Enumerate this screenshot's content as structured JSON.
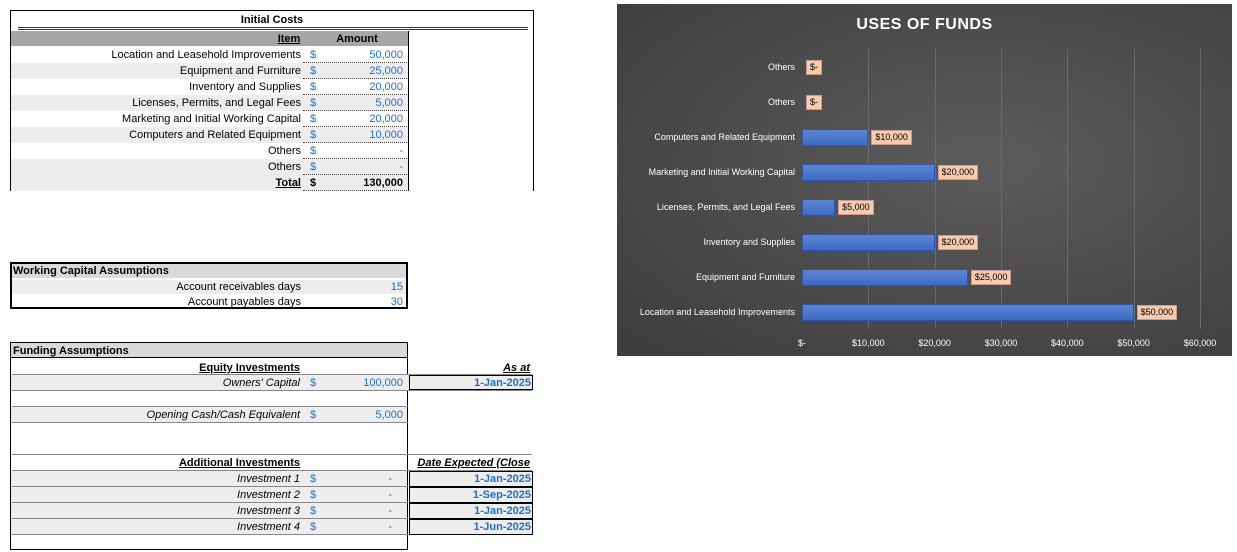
{
  "initial_costs": {
    "title": "Initial Costs",
    "col_item": "Item",
    "col_amount": "Amount",
    "rows": [
      {
        "item": "Location and Leasehold Improvements",
        "cur": "$",
        "amount": "50,000"
      },
      {
        "item": "Equipment and Furniture",
        "cur": "$",
        "amount": "25,000"
      },
      {
        "item": "Inventory and Supplies",
        "cur": "$",
        "amount": "20,000"
      },
      {
        "item": "Licenses, Permits, and Legal Fees",
        "cur": "$",
        "amount": "5,000"
      },
      {
        "item": "Marketing and Initial Working Capital",
        "cur": "$",
        "amount": "20,000"
      },
      {
        "item": "Computers and Related Equipment",
        "cur": "$",
        "amount": "10,000"
      },
      {
        "item": "Others",
        "cur": "$",
        "amount": "-"
      },
      {
        "item": "Others",
        "cur": "$",
        "amount": "-"
      }
    ],
    "total_label": "Total",
    "total_cur": "$",
    "total_amount": "130,000"
  },
  "working_capital": {
    "title": "Working Capital Assumptions",
    "rows": [
      {
        "label": "Account receivables days",
        "value": "15"
      },
      {
        "label": "Account payables days",
        "value": "30"
      }
    ]
  },
  "funding": {
    "title": "Funding Assumptions",
    "equity_header": "Equity Investments",
    "as_at_header": "As at",
    "owners_capital": {
      "label": "Owners' Capital",
      "cur": "$",
      "value": "100,000",
      "date": "1-Jan-2025"
    },
    "opening_cash": {
      "label": "Opening Cash/Cash Equivalent",
      "cur": "$",
      "value": "5,000"
    },
    "additional_header": "Additional Investments",
    "date_header": "Date Expected (Close",
    "investments": [
      {
        "label": "Investment 1",
        "cur": "$",
        "value": "-",
        "date": "1-Jan-2025"
      },
      {
        "label": "Investment 2",
        "cur": "$",
        "value": "-",
        "date": "1-Sep-2025"
      },
      {
        "label": "Investment 3",
        "cur": "$",
        "value": "-",
        "date": "1-Jan-2025"
      },
      {
        "label": "Investment 4",
        "cur": "$",
        "value": "-",
        "date": "1-Jun-2025"
      }
    ]
  },
  "chart_data": {
    "type": "bar",
    "orientation": "horizontal",
    "title": "USES OF FUNDS",
    "categories": [
      "Others",
      "Others",
      "Computers and Related Equipment",
      "Marketing and Initial Working Capital",
      "Licenses, Permits, and Legal Fees",
      "Inventory and Supplies",
      "Equipment and Furniture",
      "Location and Leasehold Improvements"
    ],
    "values": [
      0,
      0,
      10000,
      20000,
      5000,
      20000,
      25000,
      50000
    ],
    "data_labels": [
      "$-",
      "$-",
      "$10,000",
      "$20,000",
      "$5,000",
      "$20,000",
      "$25,000",
      "$50,000"
    ],
    "x_ticks": [
      "$-",
      "$10,000",
      "$20,000",
      "$30,000",
      "$40,000",
      "$50,000",
      "$60,000"
    ],
    "xlim": [
      0,
      60000
    ],
    "grid": true,
    "colors": {
      "bar": "#4472c4",
      "label_bg": "#f8cbad",
      "background": "#4d4d4d"
    }
  }
}
